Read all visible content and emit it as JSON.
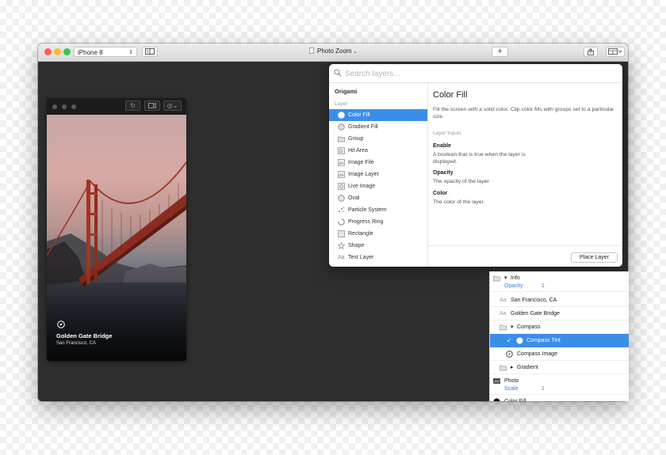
{
  "toolbar": {
    "device": "iPhone 8",
    "title": "Photo Zoom",
    "add_label": "+"
  },
  "preview": {
    "caption_title": "Golden Gate Bridge",
    "caption_subtitle": "San Francisco, CA"
  },
  "popover": {
    "search_placeholder": "Search layers...",
    "group_label": "Origami",
    "section_label": "Layer",
    "items": [
      {
        "label": "Color Fill",
        "icon": "color-fill-icon"
      },
      {
        "label": "Gradient Fill",
        "icon": "gradient-fill-icon"
      },
      {
        "label": "Group",
        "icon": "folder-icon"
      },
      {
        "label": "Hit Area",
        "icon": "hit-area-icon"
      },
      {
        "label": "Image File",
        "icon": "image-file-icon"
      },
      {
        "label": "Image Layer",
        "icon": "image-layer-icon"
      },
      {
        "label": "Live Image",
        "icon": "live-image-icon"
      },
      {
        "label": "Oval",
        "icon": "oval-icon"
      },
      {
        "label": "Particle System",
        "icon": "particle-icon"
      },
      {
        "label": "Progress Ring",
        "icon": "progress-ring-icon"
      },
      {
        "label": "Rectangle",
        "icon": "rectangle-icon"
      },
      {
        "label": "Shape",
        "icon": "star-icon"
      },
      {
        "label": "Text Layer",
        "icon": "text-icon"
      }
    ],
    "detail": {
      "title": "Color Fill",
      "description": "Fill the screen with a solid color. Clip color fills with groups set to a particular size.",
      "inputs_label": "Layer Inputs",
      "inputs": [
        {
          "name": "Enable",
          "description": "A boolean that is true when the layer is displayed."
        },
        {
          "name": "Opacity",
          "description": "The opacity of the layer."
        },
        {
          "name": "Color",
          "description": "The color of the layer."
        }
      ],
      "place_button": "Place Layer"
    }
  },
  "layers": {
    "rows": [
      {
        "label": "Info"
      },
      {
        "prop": "Opacity",
        "value": "1"
      },
      {
        "label": "San Francisco, CA"
      },
      {
        "label": "Golden Gate Bridge"
      },
      {
        "label": "Compass"
      },
      {
        "label": "Compass Tint"
      },
      {
        "label": "Compass Image"
      },
      {
        "label": "Gradient"
      },
      {
        "label": "Photo"
      },
      {
        "prop": "Scale",
        "value": "1"
      },
      {
        "label": "Color Fill"
      }
    ]
  },
  "colors": {
    "accent": "#3b8ee8",
    "canvas": "#2e2e2e"
  }
}
